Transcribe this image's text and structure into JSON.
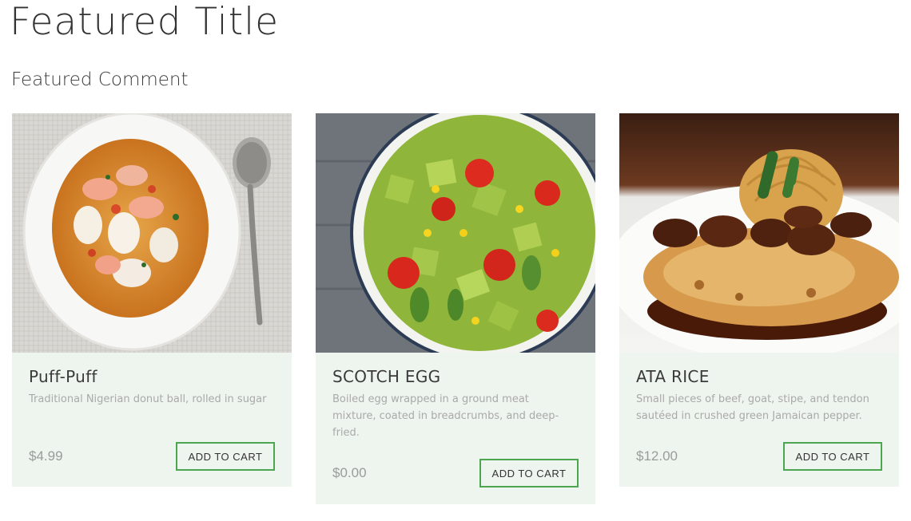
{
  "header": {
    "title": "Featured Title",
    "subtitle": "Featured Comment"
  },
  "products": [
    {
      "name": "Puff-Puff",
      "description": "Traditional Nigerian donut ball, rolled in sugar",
      "price": "$4.99",
      "button_label": "ADD TO CART",
      "image": "seafood-soup-bowl-with-spoon"
    },
    {
      "name": "SCOTCH EGG",
      "description": "Boiled egg wrapped in a ground meat mixture, coated in breadcrumbs, and deep-fried.",
      "price": "$0.00",
      "button_label": "ADD TO CART",
      "image": "avocado-tomato-corn-salad-plate"
    },
    {
      "name": "ATA RICE",
      "description": "Small pieces of beef, goat, stipe, and tendon sautéed in crushed green Jamaican pepper.",
      "price": "$12.00",
      "button_label": "ADD TO CART",
      "image": "chicken-mushroom-pasta-plate"
    }
  ],
  "colors": {
    "card_background": "#eef4ee",
    "button_border": "#4ca64f",
    "text_muted": "#a9aaa9"
  }
}
